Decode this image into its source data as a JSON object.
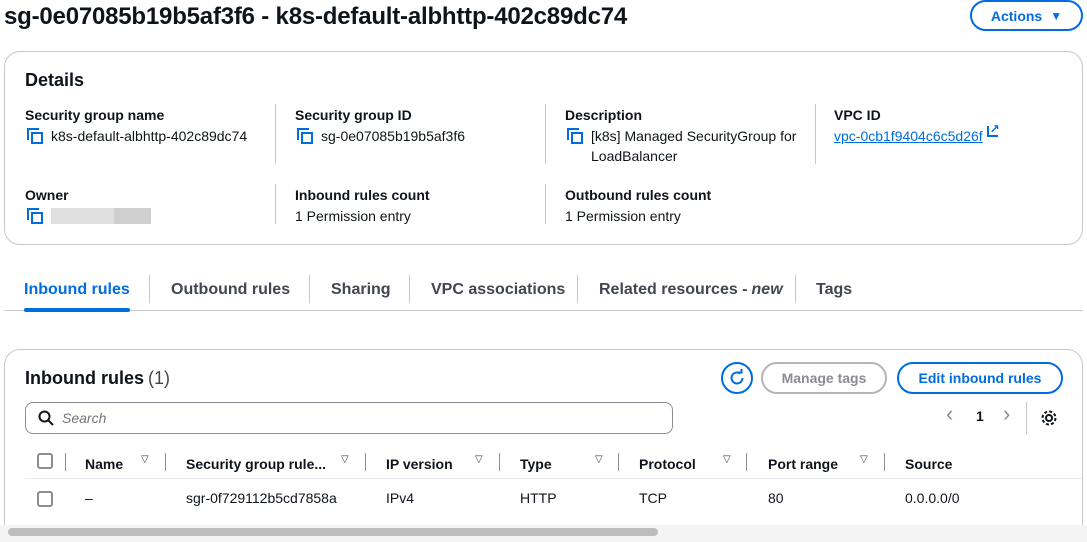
{
  "page": {
    "title": "sg-0e07085b19b5af3f6 - k8s-default-albhttp-402c89dc74",
    "actions_label": "Actions",
    "actions_caret": "▼"
  },
  "details": {
    "title": "Details",
    "security_group_name": {
      "label": "Security group name",
      "value": "k8s-default-albhttp-402c89dc74"
    },
    "security_group_id": {
      "label": "Security group ID",
      "value": "sg-0e07085b19b5af3f6"
    },
    "description": {
      "label": "Description",
      "value": "[k8s] Managed SecurityGroup for LoadBalancer"
    },
    "vpc_id": {
      "label": "VPC ID",
      "value": "vpc-0cb1f9404c6c5d26f"
    },
    "owner": {
      "label": "Owner"
    },
    "inbound_count": {
      "label": "Inbound rules count",
      "value": "1 Permission entry"
    },
    "outbound_count": {
      "label": "Outbound rules count",
      "value": "1 Permission entry"
    }
  },
  "tabs": [
    {
      "label": "Inbound rules"
    },
    {
      "label": "Outbound rules"
    },
    {
      "label": "Sharing"
    },
    {
      "label": "VPC associations"
    },
    {
      "label": "Related resources -",
      "suffix": "new"
    },
    {
      "label": "Tags"
    }
  ],
  "inbound": {
    "title": "Inbound rules",
    "count": "(1)",
    "manage_tags_label": "Manage tags",
    "edit_label": "Edit inbound rules",
    "search_placeholder": "Search",
    "page_number": "1",
    "prev_glyph": "‹",
    "next_glyph": "›",
    "sort_glyph": "▽",
    "columns": [
      "Name",
      "Security group rule...",
      "IP version",
      "Type",
      "Protocol",
      "Port range",
      "Source"
    ],
    "rows": [
      {
        "name": "–",
        "rule_id": "sgr-0f729112b5cd7858a",
        "ip_version": "IPv4",
        "type": "HTTP",
        "protocol": "TCP",
        "port_range": "80",
        "source": "0.0.0.0/0"
      }
    ]
  },
  "colors": {
    "accent": "#006ce0",
    "border": "#c6c6cd",
    "text": "#0f141a",
    "disabled": "#8c8c94"
  }
}
